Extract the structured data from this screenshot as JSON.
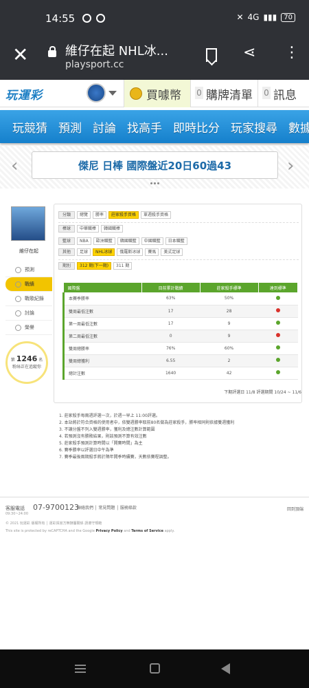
{
  "status": {
    "time": "14:55",
    "battery": "70",
    "net": "4G"
  },
  "browser": {
    "title": "維仔在起 NHL冰...",
    "url": "playsport.cc"
  },
  "site": {
    "logo": "玩運彩",
    "coins_label": "買噱幣",
    "cart_count": "0",
    "cart_label": "購牌清單",
    "msg_count": "0",
    "msg_label": "訊息"
  },
  "nav": [
    "玩競猜",
    "預測",
    "討論",
    "找高手",
    "即時比分",
    "玩家搜尋",
    "數據"
  ],
  "banner": {
    "text": "傑尼 日棒 國際盤近20日60過43"
  },
  "sidebar": {
    "name": "維仔在起",
    "menu": [
      "預測",
      "戰績",
      "戰歌紀錄",
      "討論",
      "榮譽"
    ],
    "rank_prefix": "第",
    "rank_num": "1246",
    "rank_suffix": "名",
    "rank_note": "粉絲正在追蹤你"
  },
  "filters": {
    "category": {
      "label": "分類",
      "items": [
        "總覽",
        "勝率",
        "莊家殺手資格",
        "單週殺手資格"
      ]
    },
    "baseball": {
      "label": "棒球",
      "items": [
        "中華職棒",
        "韓國職棒"
      ]
    },
    "basketball": {
      "label": "籃球",
      "items": [
        "NBA",
        "歐洲職籃",
        "韓國職籃",
        "中國職籃",
        "日本職籃"
      ]
    },
    "other": {
      "label": "其他",
      "items": [
        "足球",
        "NHL冰球",
        "俄羅斯冰球",
        "賽馬",
        "美式足球"
      ]
    },
    "period": {
      "label": "期別",
      "items": [
        "312 期(下一期)",
        "311 期"
      ]
    }
  },
  "table": {
    "headers": [
      "國際盤",
      "目前累計戰績",
      "莊家殺手標準",
      "達到標準"
    ],
    "rows": [
      {
        "name": "本賽季勝率",
        "cur": "63%",
        "std": "50%",
        "ok": true
      },
      {
        "name": "雙周最低注數",
        "cur": "17",
        "std": "28",
        "ok": false
      },
      {
        "name": "第一周最低注數",
        "cur": "17",
        "std": "9",
        "ok": true
      },
      {
        "name": "第二周最低注數",
        "cur": "0",
        "std": "9",
        "ok": false
      },
      {
        "name": "雙周總勝率",
        "cur": "76%",
        "std": "60%",
        "ok": true
      },
      {
        "name": "雙周總獲利",
        "cur": "6.55",
        "std": "2",
        "ok": true
      },
      {
        "name": "總計注數",
        "cur": "1640",
        "std": "42",
        "ok": true
      }
    ],
    "period_text": "下期評選日 11/8   評選期間 10/24 ~ 11/6"
  },
  "rules": [
    "1. 莊家殺手每兩週評選一次，於週一早上 11:00評選。",
    "2. 本站將於符合資格的使用者中，依雙週勝率取前80名做為莊家殺手，勝率相同則依據雙週獲利",
    "3. 不讓分盤不列入雙週勝率，獲利及總注數計算範圍",
    "4. 若預測沒有勝敗結果，則該預測不算有效注數",
    "5. 莊家殺手預測計算時間以「開賽時間」為主",
    "6. 賽季勝率以評選日中午為準",
    "7. 賽季最後兩期殺手將於隔年開季時續賽，天數依賽程調整。"
  ],
  "footer": {
    "phone_label": "客服電話",
    "phone": "07-9700123",
    "hours": "09:30~24:00",
    "links": "聯絡我們 │ 常見問題 │ 服務條款",
    "top": "回到頂端",
    "copy": "© 2021 玩運彩 版權所有 │ 運彩與官方無隸屬關係 請遵守規範",
    "captcha_pre": "This site is protected by reCAPTCHA and the Google",
    "privacy": "Privacy Policy",
    "and": "and",
    "terms": "Terms of Service",
    "apply": "apply."
  }
}
